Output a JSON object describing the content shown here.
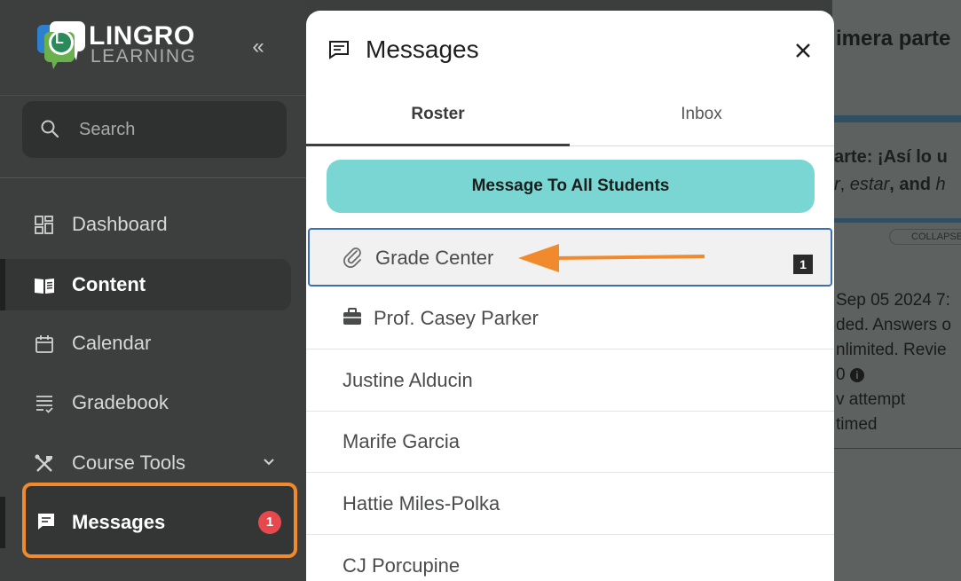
{
  "brand": {
    "name": "LINGRO",
    "sub": "LEARNING",
    "logo_letter": "L"
  },
  "sidebar": {
    "collapse_glyph": "«",
    "search_placeholder": "Search",
    "items": [
      {
        "label": "Dashboard",
        "icon": "dashboard-icon"
      },
      {
        "label": "Content",
        "icon": "book-icon",
        "active": true
      },
      {
        "label": "Calendar",
        "icon": "calendar-icon"
      },
      {
        "label": "Gradebook",
        "icon": "gradebook-icon"
      },
      {
        "label": "Course Tools",
        "icon": "tools-icon"
      },
      {
        "label": "Messages",
        "icon": "message-icon",
        "badge": "1"
      }
    ]
  },
  "background_page": {
    "title": "imera parte",
    "heading": "arte: ¡Así lo u",
    "subheading_italic1": "r",
    "subheading_sep": ", ",
    "subheading_italic2": "estar",
    "subheading_and": ", and ",
    "subheading_italic3": "h",
    "collapse_label": "COLLAPSE",
    "lines": [
      "Sep 05 2024 7:",
      "ded. Answers o",
      "nlimited. Revie",
      "0",
      "v attempt",
      " timed"
    ]
  },
  "messages_panel": {
    "title": "Messages",
    "tabs": [
      {
        "label": "Roster",
        "active": true
      },
      {
        "label": "Inbox"
      }
    ],
    "all_button": "Message To All Students",
    "rows": [
      {
        "name": "Grade Center",
        "icon": "paperclip-icon",
        "count": "1",
        "highlighted": true
      },
      {
        "name": "Prof. Casey Parker",
        "icon": "briefcase-icon"
      },
      {
        "name": "Justine Alducin"
      },
      {
        "name": "Marife Garcia"
      },
      {
        "name": "Hattie Miles-Polka"
      },
      {
        "name": "CJ Porcupine"
      }
    ]
  },
  "colors": {
    "accent_orange": "#f08a2c",
    "teal_button": "#7ad6d2",
    "badge_red": "#e5484d",
    "highlight_border": "#3d6fb0"
  }
}
